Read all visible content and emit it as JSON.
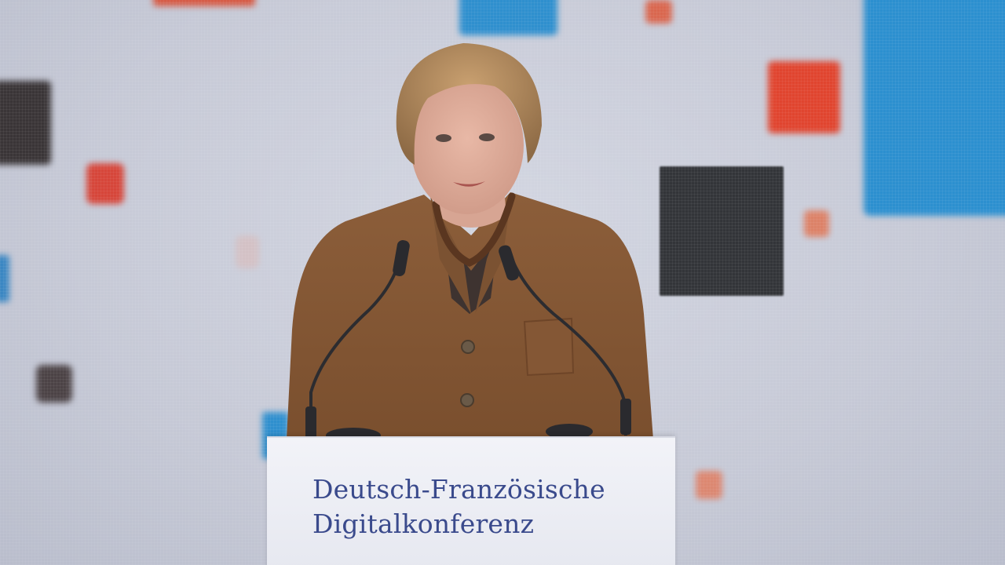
{
  "scene": {
    "description_colors": {
      "background": "#c9ccd8",
      "accent_blue": "#2a8fcf",
      "accent_red": "#d84a3a",
      "accent_dark": "#353638",
      "jacket": "#8a5c38",
      "podium_text": "#3a4a8c"
    }
  },
  "podium": {
    "line1": "Deutsch-Französische",
    "line2": "Digitalkonferenz"
  }
}
